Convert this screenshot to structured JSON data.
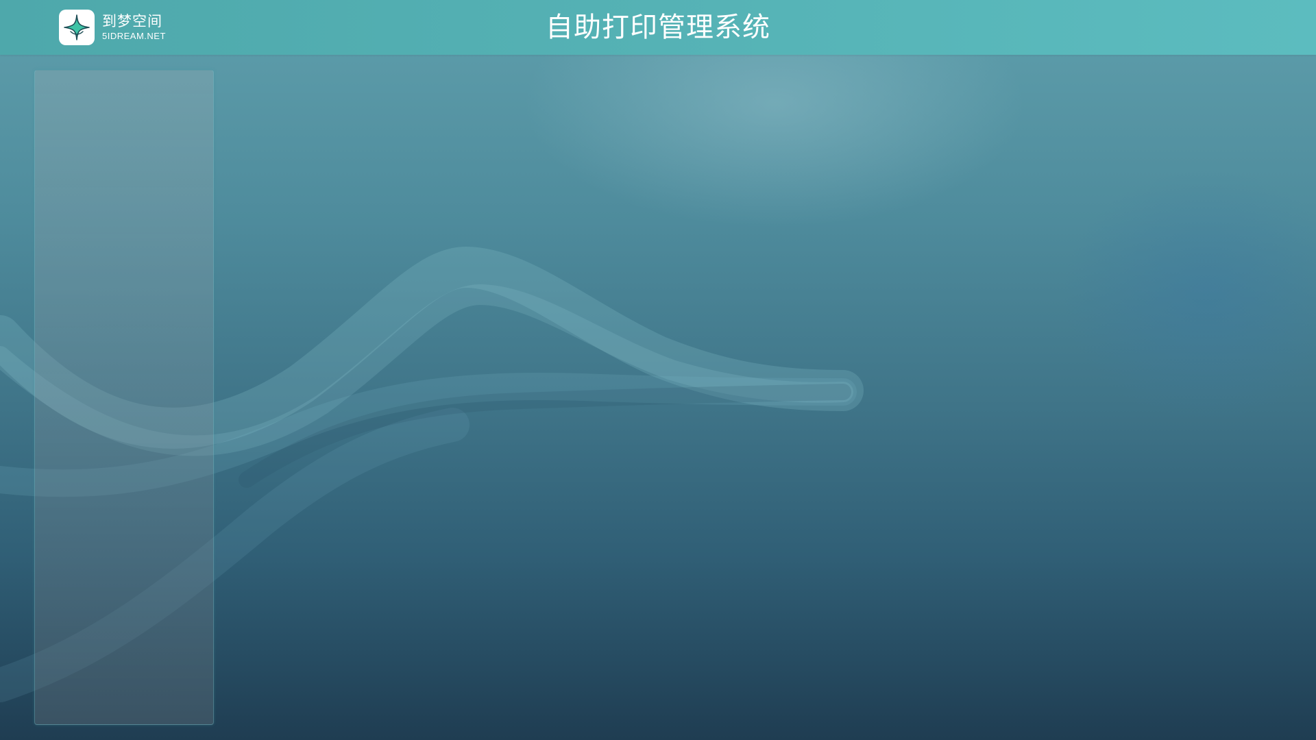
{
  "header": {
    "logo": {
      "icon": "sparkle-star-icon",
      "name_cn": "到梦空间",
      "name_en": "5IDREAM.NET"
    },
    "title": "自助打印管理系统"
  },
  "colors": {
    "header_bg": "#55b2b5",
    "logo_accent": "#3fc3a6",
    "background_top": "#5f9fac",
    "background_bottom": "#1f3d52"
  }
}
